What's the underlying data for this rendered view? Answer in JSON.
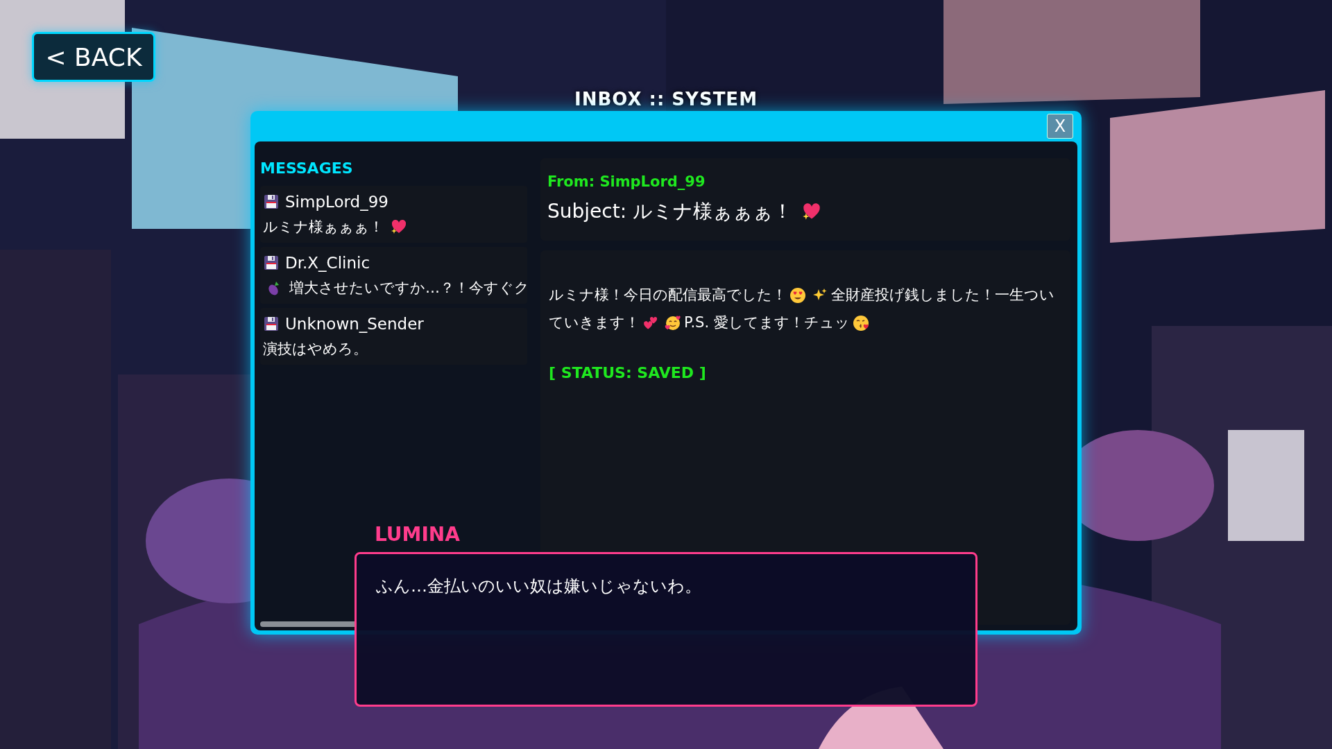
{
  "back_button": {
    "label": "< BACK"
  },
  "window": {
    "title": "INBOX :: SYSTEM",
    "close_label": "X"
  },
  "messages": {
    "heading": "MESSAGES",
    "items": [
      {
        "sender": "SimpLord_99",
        "preview": [
          {
            "kind": "text",
            "text": "ルミナ様ぁぁぁ！"
          },
          {
            "kind": "sparkling-heart"
          }
        ]
      },
      {
        "sender": "Dr.X_Clinic",
        "preview": [
          {
            "kind": "eggplant"
          },
          {
            "kind": "text",
            "text": "増大させたいですか…？！今すぐク"
          }
        ]
      },
      {
        "sender": "Unknown_Sender",
        "preview": [
          {
            "kind": "text",
            "text": "演技はやめろ。"
          }
        ]
      }
    ]
  },
  "detail": {
    "from": "From: SimpLord_99",
    "subject": [
      {
        "kind": "text",
        "text": "Subject: ルミナ様ぁぁぁ！"
      },
      {
        "kind": "sparkling-heart"
      }
    ],
    "body_lines": [
      [
        {
          "kind": "text",
          "text": "ルミナ様！今日の配信最高でした！"
        },
        {
          "kind": "heart-eyes"
        },
        {
          "kind": "sparkles"
        },
        {
          "kind": "text",
          "text": "全財産投げ銭しました！一生つい"
        }
      ],
      [
        {
          "kind": "text",
          "text": "ていきます！"
        },
        {
          "kind": "two-hearts"
        },
        {
          "kind": "face-with-hearts"
        },
        {
          "kind": "text",
          "text": "P.S. 愛してます！チュッ"
        },
        {
          "kind": "kissing-face"
        }
      ]
    ],
    "status": "[ STATUS: SAVED ]"
  },
  "dialogue": {
    "speaker": "LUMINA",
    "text": "ふん…金払いのいい奴は嫌いじゃないわ。"
  }
}
